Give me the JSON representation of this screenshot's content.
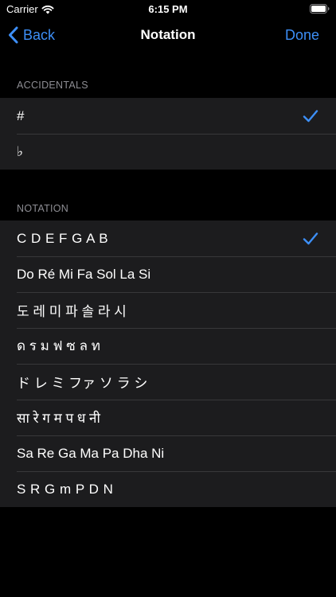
{
  "status_bar": {
    "carrier": "Carrier",
    "time": "6:15 PM"
  },
  "nav": {
    "back_label": "Back",
    "title": "Notation",
    "done_label": "Done"
  },
  "accidentals": {
    "header": "ACCIDENTALS",
    "items": [
      {
        "label": "#",
        "selected": true
      },
      {
        "label": "♭",
        "selected": false
      }
    ]
  },
  "notation": {
    "header": "NOTATION",
    "items": [
      {
        "label": "C D E F G A B",
        "selected": true
      },
      {
        "label": "Do Ré Mi Fa Sol La Si",
        "selected": false
      },
      {
        "label": "도 레 미 파 솔 라 시",
        "selected": false
      },
      {
        "label": "ด ร ม ฟ ซ ล ท",
        "selected": false
      },
      {
        "label": "ド レ ミ ファ ソ ラ シ",
        "selected": false
      },
      {
        "label": "सा रे ग म प ध नी",
        "selected": false
      },
      {
        "label": "Sa Re Ga Ma Pa Dha Ni",
        "selected": false
      },
      {
        "label": "S R G m P D N",
        "selected": false
      }
    ]
  },
  "colors": {
    "accent": "#3d8ff7",
    "background": "#000000",
    "cell_background": "#1c1c1e",
    "section_header": "#8d8d93"
  }
}
